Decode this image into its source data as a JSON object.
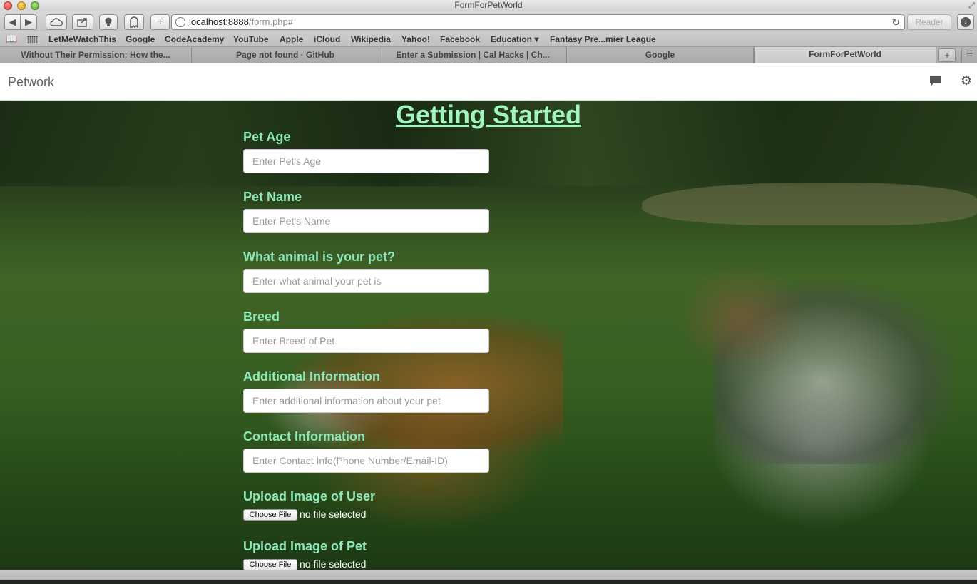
{
  "window": {
    "title": "FormForPetWorld"
  },
  "toolbar": {
    "url_host": "localhost:8888",
    "url_path": "/form.php#",
    "reader_label": "Reader",
    "add_label": "+"
  },
  "bookmarks": [
    {
      "label": "LetMeWatchThis"
    },
    {
      "label": "Google"
    },
    {
      "label": "CodeAcademy"
    },
    {
      "label": "YouTube"
    },
    {
      "label": "Apple"
    },
    {
      "label": "iCloud"
    },
    {
      "label": "Wikipedia"
    },
    {
      "label": "Yahoo!"
    },
    {
      "label": "Facebook"
    },
    {
      "label": "Education ▾"
    },
    {
      "label": "Fantasy Pre...mier League"
    }
  ],
  "tabs": [
    {
      "label": "Without Their Permission: How the..."
    },
    {
      "label": "Page not found · GitHub"
    },
    {
      "label": "Enter a Submission | Cal Hacks | Ch..."
    },
    {
      "label": "Google"
    },
    {
      "label": "FormForPetWorld",
      "active": true
    }
  ],
  "navbar": {
    "brand": "Petwork"
  },
  "form": {
    "title": "Getting Started",
    "fields": [
      {
        "label": "Pet Age",
        "placeholder": "Enter Pet's Age"
      },
      {
        "label": "Pet Name",
        "placeholder": "Enter Pet's Name"
      },
      {
        "label": "What animal is your pet?",
        "placeholder": "Enter what animal your pet is"
      },
      {
        "label": "Breed",
        "placeholder": "Enter Breed of Pet"
      },
      {
        "label": "Additional Information",
        "placeholder": "Enter additional information about your pet"
      },
      {
        "label": "Contact Information",
        "placeholder": "Enter Contact Info(Phone Number/Email-ID)"
      }
    ],
    "uploads": [
      {
        "label": "Upload Image of User",
        "button": "Choose File",
        "status": "no file selected"
      },
      {
        "label": "Upload Image of Pet",
        "button": "Choose File",
        "status": "no file selected"
      }
    ]
  },
  "colors": {
    "heading": "#a3f5bf",
    "label": "#8fe8ba",
    "background_grass": "#4f7a2e"
  },
  "icons": [
    "back-icon",
    "forward-icon",
    "cloud-icon",
    "share-icon",
    "lightbulb-icon",
    "ghostery-icon",
    "globe-icon",
    "reload-icon",
    "download-icon",
    "book-icon",
    "grid-icon",
    "chat-icon",
    "gear-icon"
  ]
}
